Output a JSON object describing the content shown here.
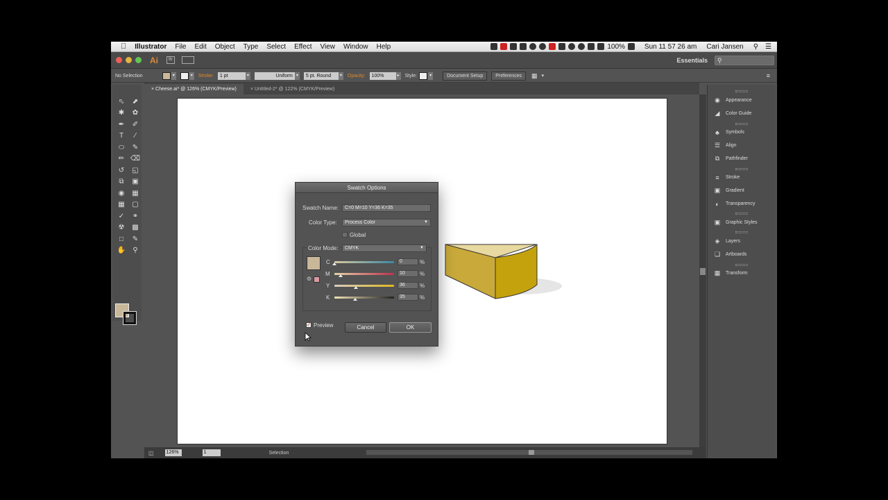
{
  "menubar": {
    "apple": "",
    "app": "Illustrator",
    "menus": [
      "File",
      "Edit",
      "Object",
      "Type",
      "Select",
      "Effect",
      "View",
      "Window",
      "Help"
    ],
    "battery": "100%",
    "clock": "Sun 11 57 26 am",
    "user": "Cari Jansen"
  },
  "appbar": {
    "logo": "Ai",
    "bridge": "Br",
    "workspace": "Essentials",
    "search_placeholder": ""
  },
  "control": {
    "selection": "No Selection",
    "stroke_label": "Stroke:",
    "stroke_weight": "1 pt",
    "profile": "Uniform",
    "brush": "5 pt. Round",
    "opacity_label": "Opacity:",
    "opacity": "100%",
    "style_label": "Style:",
    "document_setup": "Document Setup",
    "preferences": "Preferences"
  },
  "tabs": [
    {
      "label": "Cheese.ai* @ 126% (CMYK/Preview)"
    },
    {
      "label": "Untitled-2* @ 122% (CMYK/Preview)"
    }
  ],
  "status": {
    "zoom": "126%",
    "page": "1",
    "tool": "Selection"
  },
  "panels": [
    {
      "label": "Appearance",
      "icon": "appearance-icon"
    },
    {
      "label": "Color Guide",
      "icon": "color-guide-icon"
    },
    {
      "label": "Symbols",
      "icon": "symbols-icon"
    },
    {
      "label": "Align",
      "icon": "align-icon"
    },
    {
      "label": "Pathfinder",
      "icon": "pathfinder-icon"
    },
    {
      "label": "Stroke",
      "icon": "stroke-icon"
    },
    {
      "label": "Gradient",
      "icon": "gradient-icon"
    },
    {
      "label": "Transparency",
      "icon": "transparency-icon"
    },
    {
      "label": "Graphic Styles",
      "icon": "graphic-styles-icon"
    },
    {
      "label": "Layers",
      "icon": "layers-icon"
    },
    {
      "label": "Artboards",
      "icon": "artboards-icon"
    },
    {
      "label": "Transform",
      "icon": "transform-icon"
    }
  ],
  "dialog": {
    "title": "Swatch Options",
    "swatch_name_label": "Swatch Name:",
    "swatch_name": "C=0 M=10 Y=36 K=35",
    "color_type_label": "Color Type:",
    "color_type": "Process Color",
    "global_label": "Global",
    "color_mode_label": "Color Mode:",
    "color_mode": "CMYK",
    "channels": [
      {
        "key": "C",
        "value": "0",
        "unit": "%",
        "level": 0
      },
      {
        "key": "M",
        "value": "10",
        "unit": "%",
        "level": 10
      },
      {
        "key": "Y",
        "value": "36",
        "unit": "%",
        "level": 36
      },
      {
        "key": "K",
        "value": "35",
        "unit": "%",
        "level": 35
      }
    ],
    "preview_label": "Preview",
    "cancel": "Cancel",
    "ok": "OK"
  },
  "colors": {
    "swatch": "#c9b79a",
    "cheese_top": "#e8d9a0",
    "cheese_side": "#c9a93a",
    "cheese_front": "#c4a20e",
    "ai_orange": "#d98a3f"
  }
}
